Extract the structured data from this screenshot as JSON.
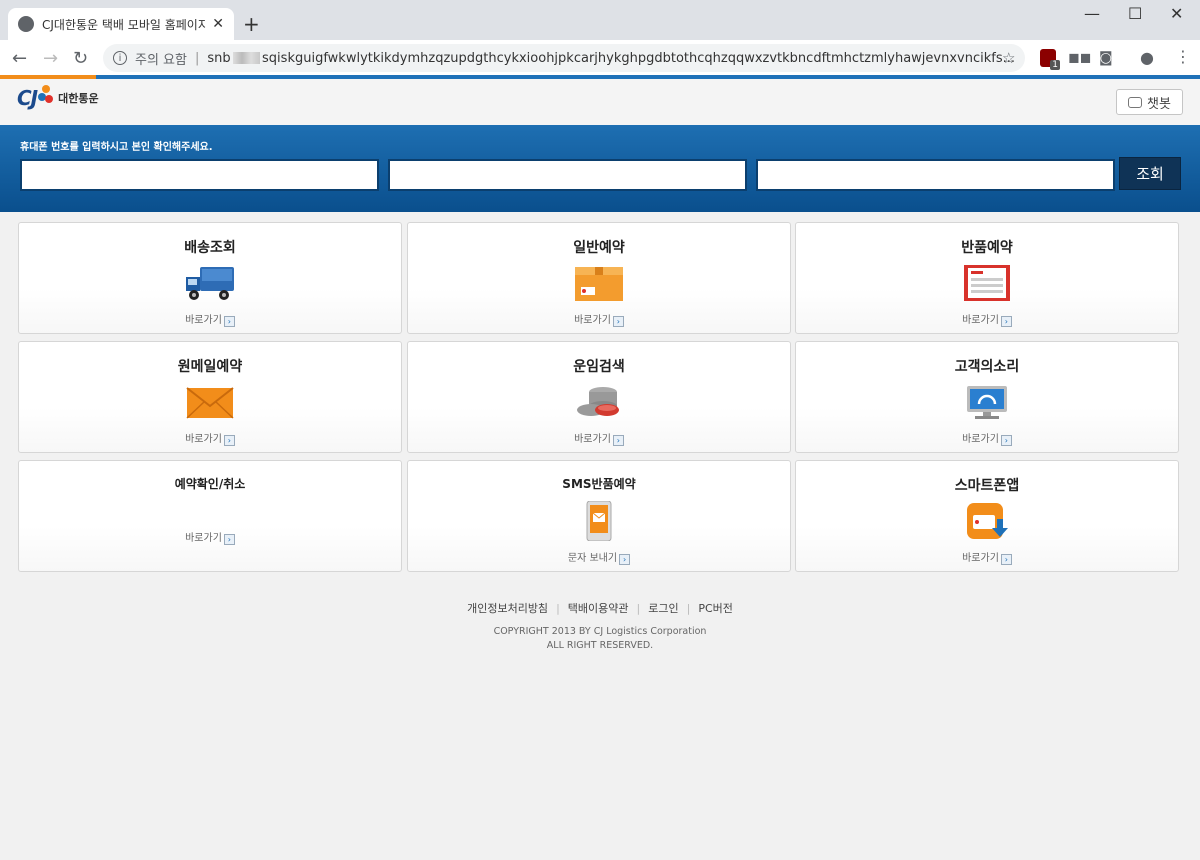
{
  "browser": {
    "tab_title": "CJ대한통운 택배 모바일 홈페이지",
    "url_warning": "주의 요함",
    "url_prefix": "snb",
    "url_rest": "sqiskguigfwkwlytkikdymhzqzupdgthcykxioohjpkcarjhykghpgdbtothcqhzqqwxzvtkbncdftmhctzmlyhawjevnxvncikfs...",
    "ext_badge_count": "1",
    "page_load_progress": 0.08
  },
  "header": {
    "logo_text": "CJ",
    "logo_name": "대한통운",
    "chatbot_label": "챗봇"
  },
  "search": {
    "hint": "휴대폰 번호를 입력하시고 본인 확인해주세요.",
    "submit_label": "조회"
  },
  "menu": [
    {
      "title": "배송조회",
      "link": "바로가기",
      "icon": "truck-icon"
    },
    {
      "title": "일반예약",
      "link": "바로가기",
      "icon": "box-icon"
    },
    {
      "title": "반품예약",
      "link": "바로가기",
      "icon": "form-icon"
    },
    {
      "title": "원메일예약",
      "link": "바로가기",
      "icon": "envelope-icon"
    },
    {
      "title": "운임검색",
      "link": "바로가기",
      "icon": "coins-icon"
    },
    {
      "title": "고객의소리",
      "link": "바로가기",
      "icon": "monitor-icon"
    },
    {
      "title": "예약확인/취소",
      "link": "바로가기",
      "icon": ""
    },
    {
      "title": "SMS반품예약",
      "link": "문자 보내기",
      "icon": "phone-sms-icon"
    },
    {
      "title": "스마트폰앱",
      "link": "바로가기",
      "icon": "app-download-icon"
    }
  ],
  "footer": {
    "links": [
      "개인정보처리방침",
      "택배이용약관",
      "로그인",
      "PC버전"
    ],
    "copyright_line1": "COPYRIGHT 2013 BY CJ Logistics Corporation",
    "copyright_line2": "ALL RIGHT RESERVED."
  },
  "colors": {
    "band": "#0a4f8d",
    "accent_orange": "#f28d1a",
    "submit_bg": "#0f3356"
  }
}
